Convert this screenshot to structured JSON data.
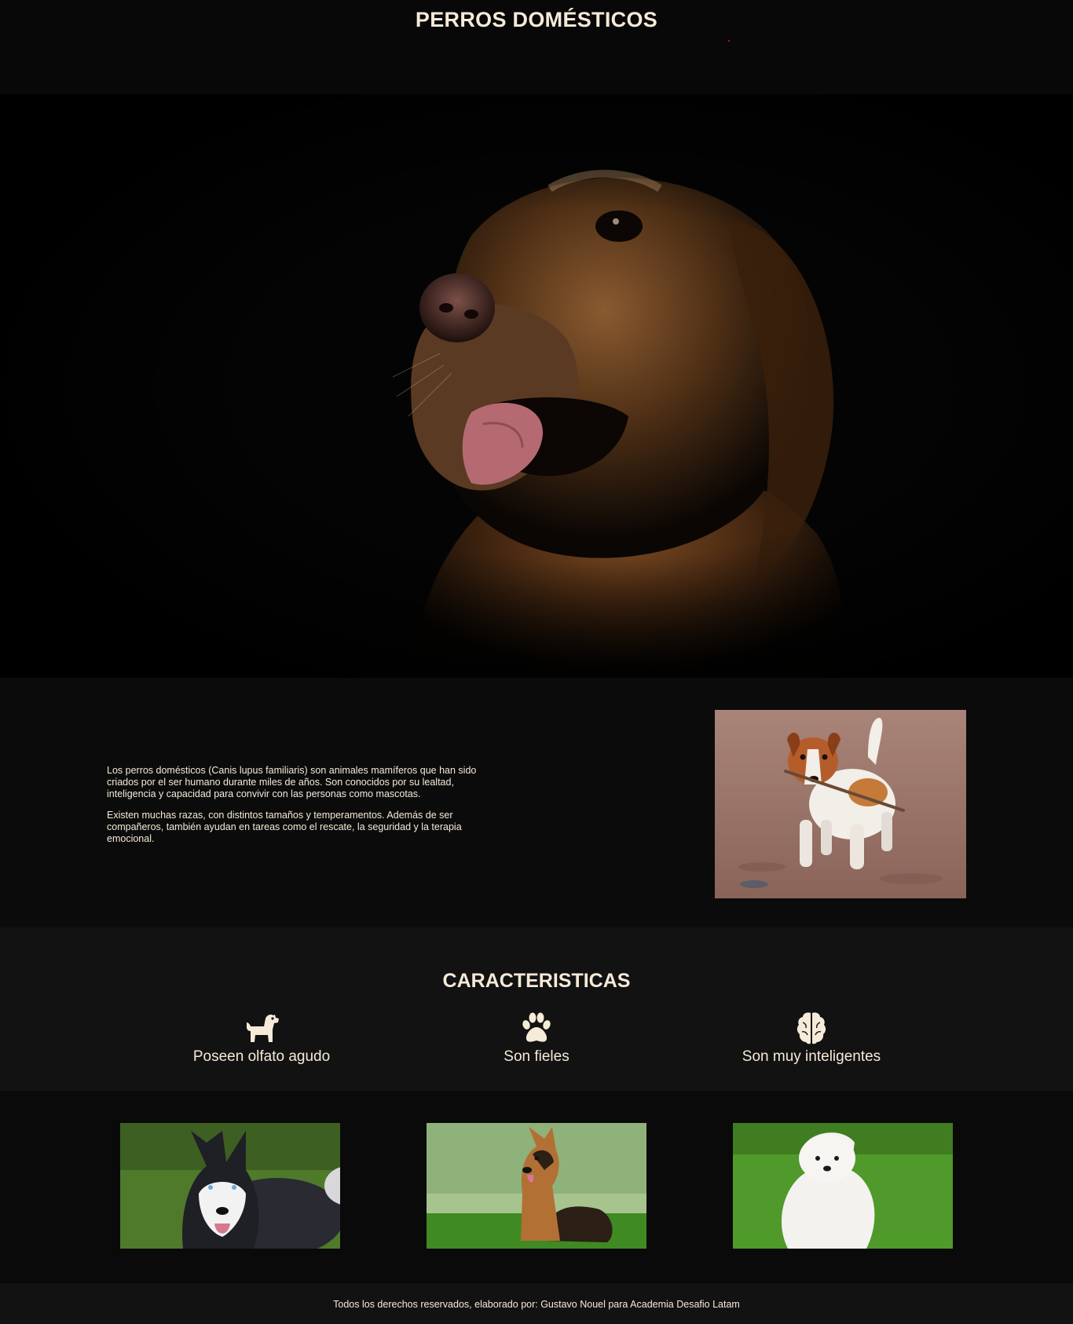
{
  "header": {
    "title": "PERROS DOMÉSTICOS"
  },
  "hero": {
    "image": "golden-retriever-portrait"
  },
  "intro": {
    "paragraphs": [
      "Los perros domésticos (Canis lupus familiaris) son animales mamíferos que han sido criados por el ser humano durante miles de años. Son conocidos por su lealtad, inteligencia y capacidad para convivir con las personas como mascotas.",
      "Existen muchas razas, con distintos tamaños y temperamentos. Además de ser compañeros, también ayudan en tareas como el rescate, la seguridad y la terapia emocional."
    ],
    "image": "jack-russell-with-stick"
  },
  "features": {
    "title": "CARACTERISTICAS",
    "items": [
      {
        "icon": "dog-icon",
        "label": "Poseen olfato agudo"
      },
      {
        "icon": "paw-icon",
        "label": "Son fieles"
      },
      {
        "icon": "brain-icon",
        "label": "Son muy inteligentes"
      }
    ]
  },
  "gallery": {
    "items": [
      {
        "image": "husky-photo"
      },
      {
        "image": "german-shepherd-photo"
      },
      {
        "image": "maltese-photo"
      }
    ]
  },
  "footer": {
    "text": "Todos los derechos reservados, elaborado por: Gustavo Nouel para Academia Desafio Latam"
  },
  "colors": {
    "background": "#0a0a0a",
    "section_alt": "#121212",
    "text": "#f6ead8"
  }
}
